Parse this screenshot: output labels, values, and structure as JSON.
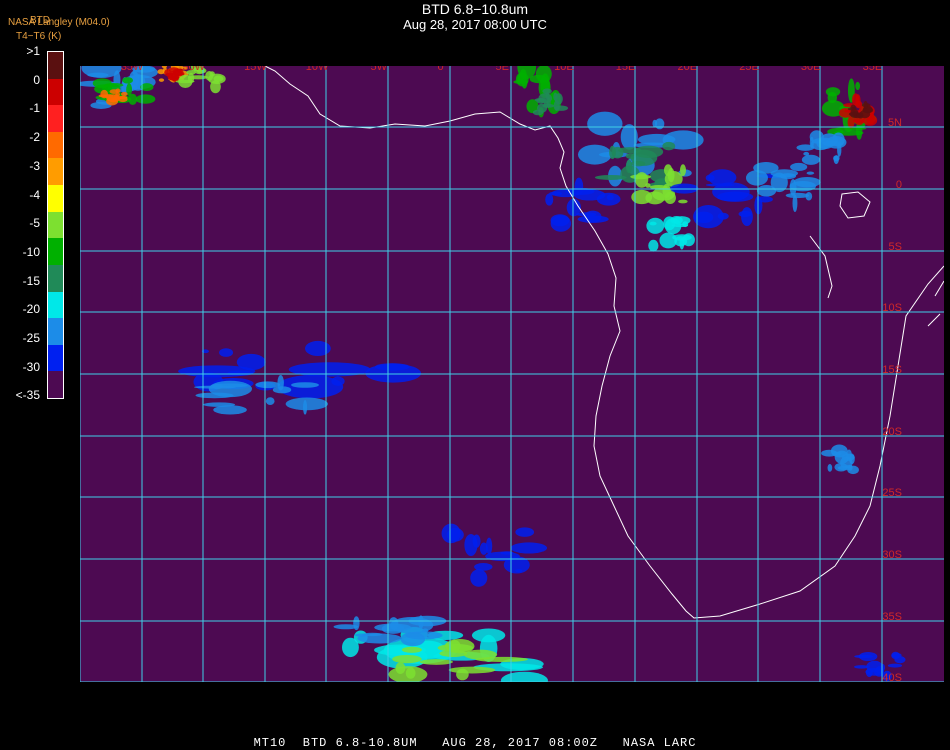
{
  "header": {
    "title": "BTD 6.8−10.8um",
    "subtitle": "Aug 28, 2017 08:00 UTC",
    "producer": "NASA Langley (M04.0)",
    "product_id": "BTD",
    "units": "T4−T6 (K)"
  },
  "legend": {
    "labels": [
      ">1",
      "0",
      "-1",
      "-2",
      "-3",
      "-4",
      "-5",
      "-10",
      "-15",
      "-20",
      "-25",
      "-30",
      "<-35"
    ],
    "colors": [
      "#5a1010",
      "#cc0000",
      "#ff2020",
      "#ff6a00",
      "#ff9c00",
      "#ffff00",
      "#7de030",
      "#00b000",
      "#208a58",
      "#00e8e8",
      "#1c8ce8",
      "#0020f0",
      "#4d0a52"
    ]
  },
  "map": {
    "background_color": "#4d0a52",
    "grid_color": "#3fd0e8",
    "label_color": "#d02828",
    "coast_color": "#ffffff",
    "lon_labels": [
      "35W",
      "30W",
      "15W",
      "10W",
      "5W",
      "0",
      "5E",
      "10E",
      "15E",
      "20E",
      "25E",
      "30E",
      "35E"
    ],
    "lat_labels": [
      "5N",
      "0",
      "5S",
      "10S",
      "15S",
      "20S",
      "25S",
      "30S",
      "35S",
      "40S"
    ]
  },
  "footer": {
    "text": "MT10  BTD 6.8-10.8UM   AUG 28, 2017 08:00Z   NASA LARC"
  }
}
